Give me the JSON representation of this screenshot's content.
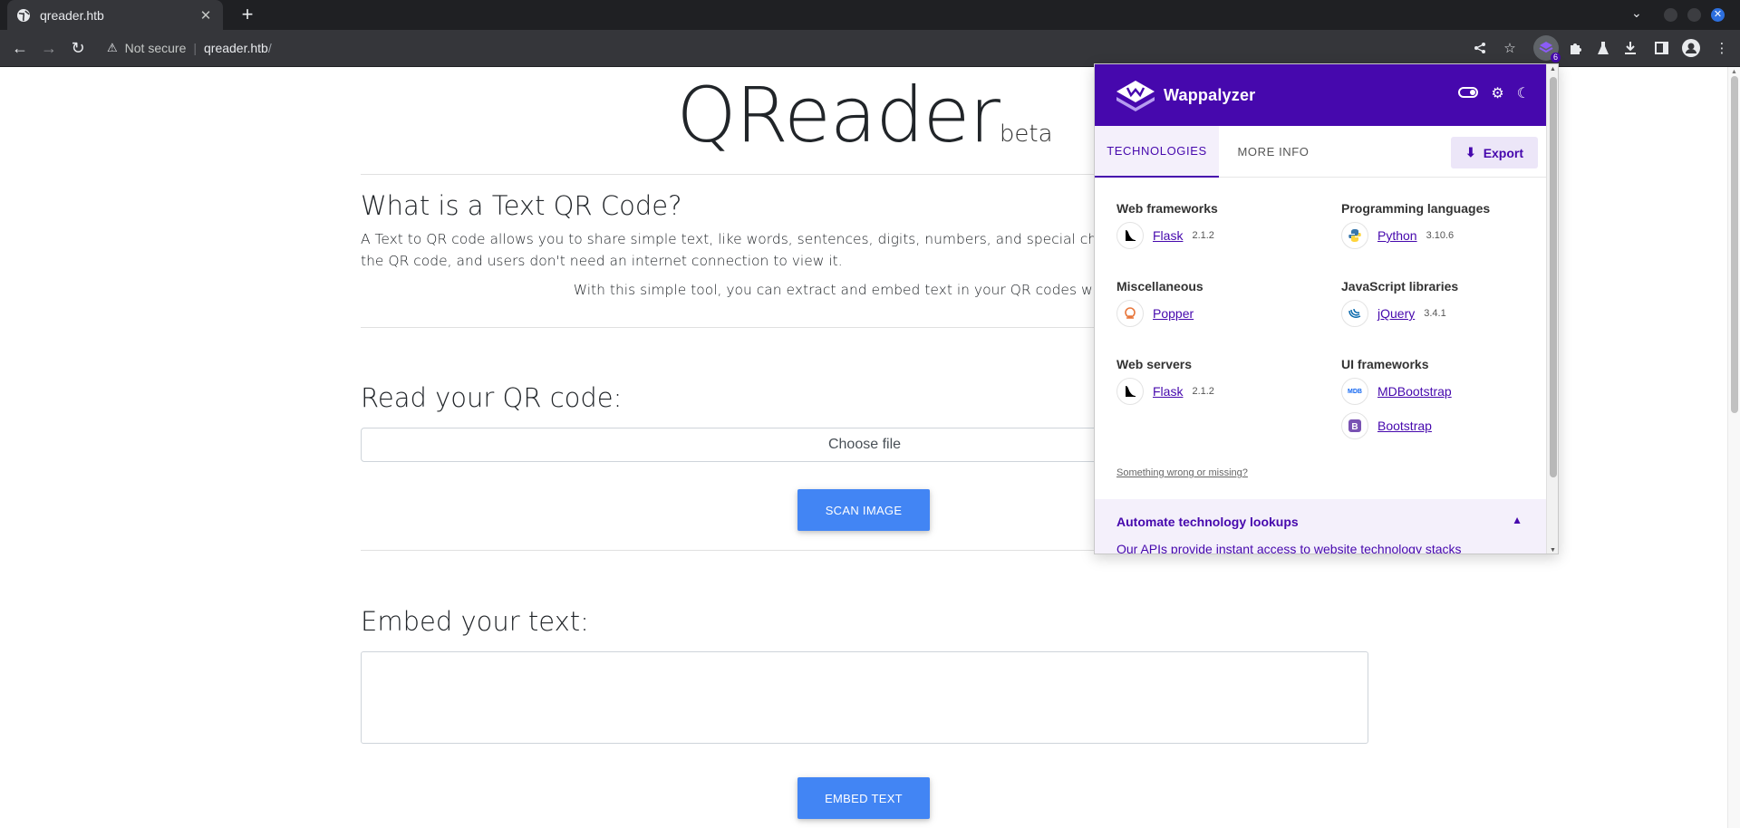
{
  "browser": {
    "tab_title": "qreader.htb",
    "new_tab": "+",
    "close_tab": "✕",
    "security_label": "Not secure",
    "url_host": "qreader.htb",
    "url_path": "/"
  },
  "page": {
    "brand_title": "QReader",
    "brand_sup": "beta",
    "about_heading": "What is a Text QR Code?",
    "about_text": "A Text to QR code allows you to share simple text, like words, sentences, digits, numbers, and special characters. The",
    "about_text_2": "the QR code, and users don't need an internet connection to view it.",
    "about_text_3": "With this simple tool, you can extract and embed text in your QR codes with no eff",
    "read_heading": "Read your QR code:",
    "choose_file_label": "Choose file",
    "scan_button": "SCAN IMAGE",
    "embed_heading": "Embed your text:",
    "embed_button": "EMBED TEXT"
  },
  "wappalyzer": {
    "brand": "Wappalyzer",
    "badge_count": "6",
    "tabs": [
      "TECHNOLOGIES",
      "MORE INFO"
    ],
    "export_label": "Export",
    "categories": [
      {
        "name": "Web frameworks",
        "items": [
          {
            "name": "Flask",
            "version": "2.1.2",
            "icon": "flask-icon"
          }
        ]
      },
      {
        "name": "Programming languages",
        "items": [
          {
            "name": "Python",
            "version": "3.10.6",
            "icon": "python-icon"
          }
        ]
      },
      {
        "name": "Miscellaneous",
        "items": [
          {
            "name": "Popper",
            "version": "",
            "icon": "popper-icon"
          }
        ]
      },
      {
        "name": "JavaScript libraries",
        "items": [
          {
            "name": "jQuery",
            "version": "3.4.1",
            "icon": "jquery-icon"
          }
        ]
      },
      {
        "name": "Web servers",
        "items": [
          {
            "name": "Flask",
            "version": "2.1.2",
            "icon": "flask-icon"
          }
        ]
      },
      {
        "name": "UI frameworks",
        "items": [
          {
            "name": "MDBootstrap",
            "version": "",
            "icon": "mdbootstrap-icon"
          },
          {
            "name": "Bootstrap",
            "version": "",
            "icon": "bootstrap-icon"
          }
        ]
      }
    ],
    "wrong_link": "Something wrong or missing?",
    "automate_title": "Automate technology lookups",
    "automate_text": "Our APIs provide instant access to website technology stacks",
    "colors": {
      "brand": "#4608ad",
      "brand_light": "#f4f0fb"
    }
  }
}
